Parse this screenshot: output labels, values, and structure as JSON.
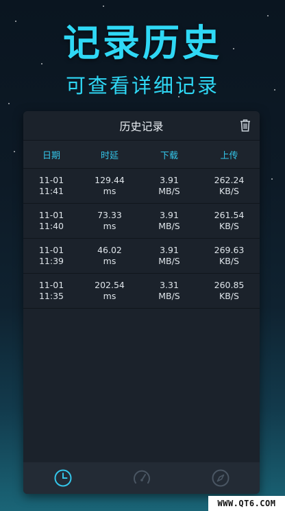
{
  "promo": {
    "headline": "记录历史",
    "subline": "可查看详细记录"
  },
  "card": {
    "title": "历史记录",
    "columns": [
      "日期",
      "时延",
      "下载",
      "上传"
    ],
    "rows": [
      {
        "date": "11-01",
        "time": "11:41",
        "latency": "129.44",
        "latency_unit": "ms",
        "download": "3.91",
        "download_unit": "MB/S",
        "upload": "262.24",
        "upload_unit": "KB/S"
      },
      {
        "date": "11-01",
        "time": "11:40",
        "latency": "73.33",
        "latency_unit": "ms",
        "download": "3.91",
        "download_unit": "MB/S",
        "upload": "261.54",
        "upload_unit": "KB/S"
      },
      {
        "date": "11-01",
        "time": "11:39",
        "latency": "46.02",
        "latency_unit": "ms",
        "download": "3.91",
        "download_unit": "MB/S",
        "upload": "269.63",
        "upload_unit": "KB/S"
      },
      {
        "date": "11-01",
        "time": "11:35",
        "latency": "202.54",
        "latency_unit": "ms",
        "download": "3.31",
        "download_unit": "MB/S",
        "upload": "260.85",
        "upload_unit": "KB/S"
      }
    ]
  },
  "tabs": [
    {
      "icon": "clock-icon",
      "active": true
    },
    {
      "icon": "speedometer-icon",
      "active": false
    },
    {
      "icon": "compass-icon",
      "active": false
    }
  ],
  "colors": {
    "accent": "#2fd8f5",
    "header_text": "#34c6ea",
    "card_bg": "#1b222b",
    "tab_active": "#34c6ea",
    "tab_inactive": "#4a5663"
  },
  "watermark": "WWW.QT6.COM"
}
